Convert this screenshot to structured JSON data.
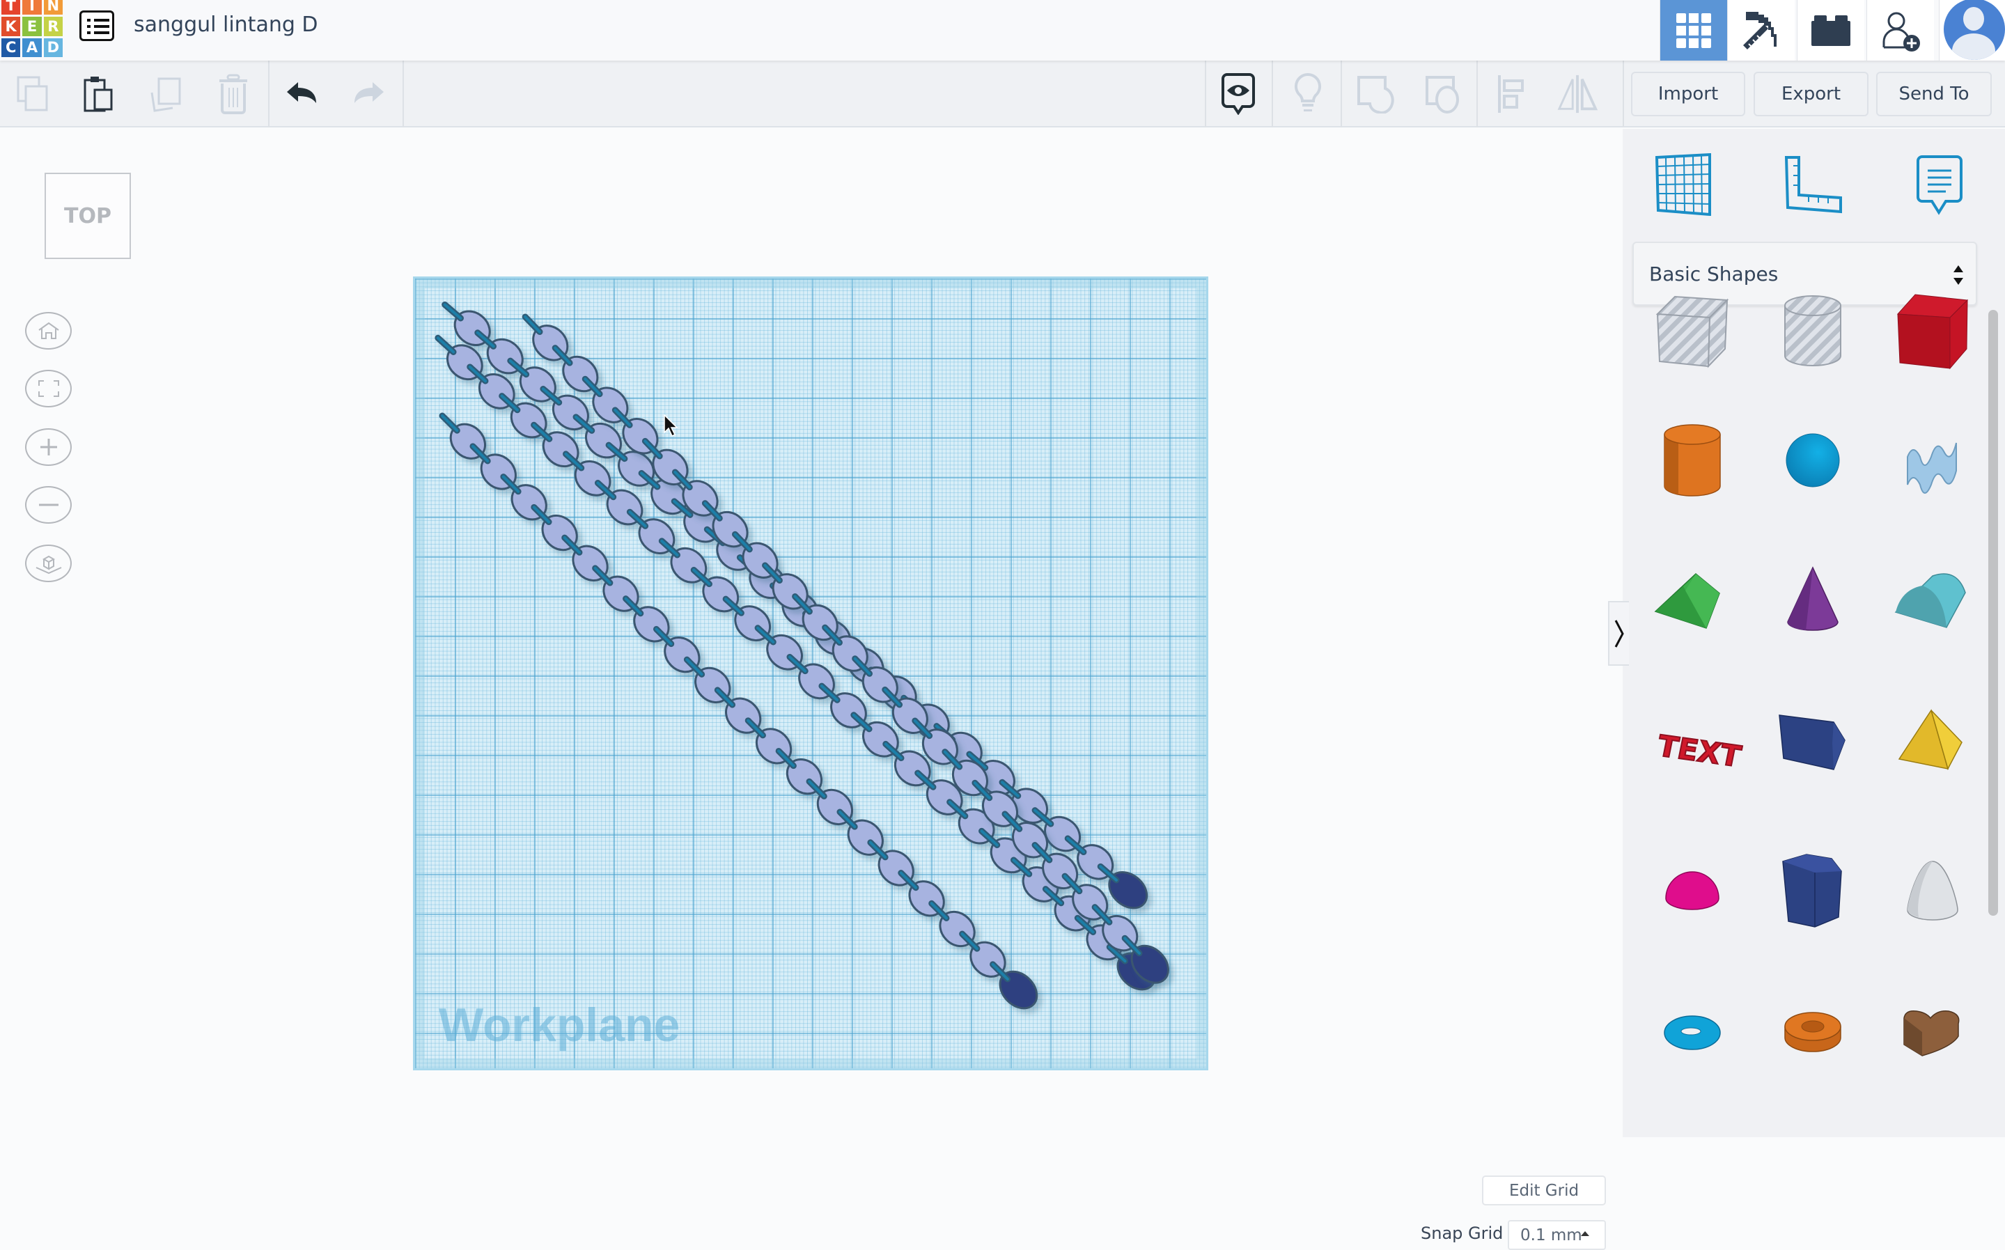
{
  "app": {
    "logo_letters": [
      "T",
      "I",
      "N",
      "K",
      "E",
      "R",
      "C",
      "A",
      "D"
    ],
    "logo_colors": [
      "#e5432c",
      "#ef7a3a",
      "#f29b38",
      "#e14d2b",
      "#8bc13f",
      "#c5d246",
      "#1f5aa6",
      "#3f8fd0",
      "#66b6e0"
    ],
    "document_title": "sanggul lintang D"
  },
  "top_nav": {
    "items": [
      {
        "name": "3d-design",
        "icon": "grid-icon",
        "active": true
      },
      {
        "name": "minecraft",
        "icon": "pickaxe-icon",
        "active": false
      },
      {
        "name": "lego",
        "icon": "brick-icon",
        "active": false
      },
      {
        "name": "invite",
        "icon": "add-user-icon",
        "active": false
      }
    ],
    "accent_color": "#5b95d6"
  },
  "toolbar": {
    "left_tools": [
      {
        "name": "copy",
        "icon": "copy-icon",
        "enabled": false
      },
      {
        "name": "paste",
        "icon": "paste-icon",
        "enabled": true
      },
      {
        "name": "duplicate",
        "icon": "duplicate-icon",
        "enabled": false
      },
      {
        "name": "delete",
        "icon": "trash-icon",
        "enabled": false
      },
      {
        "name": "undo",
        "icon": "undo-icon",
        "enabled": true
      },
      {
        "name": "redo",
        "icon": "redo-icon",
        "enabled": false
      }
    ],
    "right_tools": [
      {
        "name": "notes-visibility",
        "icon": "eye-comment-icon",
        "enabled": true
      },
      {
        "name": "lightbulb",
        "icon": "lightbulb-icon",
        "enabled": false
      },
      {
        "name": "group",
        "icon": "group-icon",
        "enabled": false
      },
      {
        "name": "ungroup",
        "icon": "ungroup-icon",
        "enabled": false
      },
      {
        "name": "align",
        "icon": "align-icon",
        "enabled": false
      },
      {
        "name": "mirror",
        "icon": "mirror-icon",
        "enabled": false
      }
    ],
    "import_label": "Import",
    "export_label": "Export",
    "send_to_label": "Send To"
  },
  "viewport": {
    "view_cube_label": "TOP",
    "nav_controls": [
      "home-view",
      "fit-all",
      "zoom-in",
      "zoom-out",
      "perspective"
    ],
    "workplane_label": "Workplane",
    "edit_grid_label": "Edit Grid",
    "snap_grid_label": "Snap Grid",
    "snap_grid_value": "0.1 mm",
    "chain_count": 4,
    "chain_link_color": "#a7b3e0",
    "chain_pin_color": "#1f7fa8",
    "chain_end_color": "#2d3f80"
  },
  "right_panel": {
    "tools": [
      "workplane-tool",
      "ruler-tool",
      "notes-tool"
    ],
    "category": "Basic Shapes",
    "shapes": [
      {
        "name": "Box Hole",
        "color": "#c5cad3"
      },
      {
        "name": "Cylinder Hole",
        "color": "#c5cad3"
      },
      {
        "name": "Box",
        "color": "#c8172a"
      },
      {
        "name": "Cylinder",
        "color": "#e07722"
      },
      {
        "name": "Sphere",
        "color": "#0ea0d8"
      },
      {
        "name": "Scribble",
        "color": "#9ec7e6"
      },
      {
        "name": "Roof",
        "color": "#3bae4a"
      },
      {
        "name": "Cone",
        "color": "#7c3a98"
      },
      {
        "name": "Round Roof",
        "color": "#5fc1cf"
      },
      {
        "name": "Text",
        "color": "#d0192b"
      },
      {
        "name": "Polygon",
        "color": "#2c4283"
      },
      {
        "name": "Pyramid",
        "color": "#e8c22c"
      },
      {
        "name": "Half Sphere",
        "color": "#df0d8c"
      },
      {
        "name": "Hexagonal Prism",
        "color": "#2c4283"
      },
      {
        "name": "Paraboloid",
        "color": "#dfe2e6"
      },
      {
        "name": "Torus",
        "color": "#10a3d8"
      },
      {
        "name": "Tube",
        "color": "#e07722"
      },
      {
        "name": "Heart",
        "color": "#8d5f3c"
      }
    ]
  }
}
